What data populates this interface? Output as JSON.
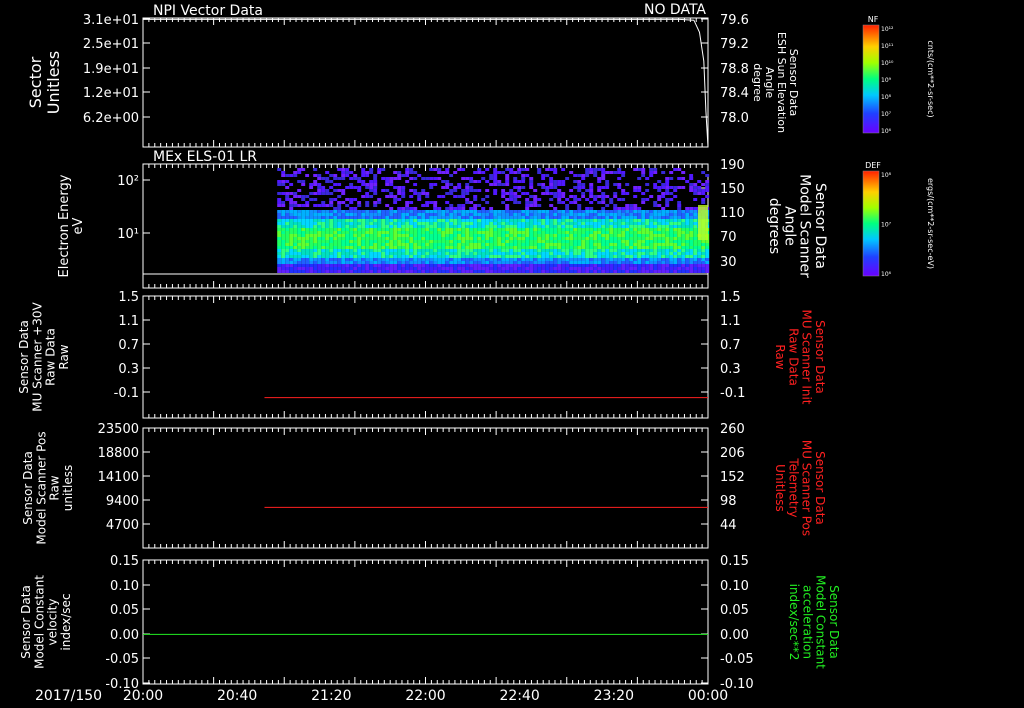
{
  "figure": {
    "date_label": "2017/150",
    "x_ticks": [
      "20:00",
      "20:40",
      "21:20",
      "22:00",
      "22:40",
      "23:20",
      "00:00"
    ],
    "colors": {
      "background": "#000000",
      "axis": "#ffffff",
      "red_trace": "#ff2020",
      "green_trace": "#22ee22"
    }
  },
  "colorbars": [
    {
      "id": "nf",
      "tag": "NF",
      "label": "cnts/(cm**2-sr-sec)",
      "ticks": [
        "10¹²",
        "10¹¹",
        "10¹⁰",
        "10⁹",
        "10⁸",
        "10⁷",
        "10⁶"
      ]
    },
    {
      "id": "def",
      "tag": "DEF",
      "label": "ergs/(cm**2-sr-sec-eV)",
      "ticks": [
        "10⁸",
        "10⁷",
        "10⁶"
      ]
    }
  ],
  "chart_data": [
    {
      "type": "line",
      "title": "NPI Vector Data",
      "status_text": "NO DATA",
      "left_axis": {
        "label_lines": [
          "Sector",
          "Unitless"
        ],
        "ticks": [
          "3.1e+01",
          "2.5e+01",
          "1.9e+01",
          "1.2e+01",
          "6.2e+00"
        ]
      },
      "right_axis": {
        "label_lines": [
          "Sensor Data",
          "ESH Sun Elevation",
          "Angle",
          "degree"
        ],
        "ticks": [
          "79.6",
          "79.2",
          "78.8",
          "78.4",
          "78.0"
        ],
        "ylim": [
          77.8,
          79.6
        ]
      },
      "series": [
        {
          "axis": "right",
          "x_hours": [
            0,
            1,
            2,
            3,
            3.8,
            3.9,
            3.94,
            3.97,
            3.985,
            4.0
          ],
          "values": [
            79.58,
            79.58,
            79.58,
            79.58,
            79.58,
            79.57,
            79.4,
            79.0,
            78.3,
            77.8
          ]
        }
      ]
    },
    {
      "type": "heatmap",
      "title": "MEx ELS-01 LR",
      "left_axis": {
        "label_lines": [
          "Electron Energy",
          "eV"
        ],
        "ticks": [
          "10²",
          "10¹"
        ],
        "scale": "log"
      },
      "right_axis": {
        "label_lines": [
          "Sensor Data",
          "Model Scanner",
          "Angle",
          "degrees"
        ],
        "ticks": [
          "190",
          "150",
          "110",
          "70",
          "30"
        ]
      },
      "data_start_hour": 0.95,
      "data_end_hour": 4.0
    },
    {
      "type": "line",
      "left_axis": {
        "label_lines": [
          "Sensor Data",
          "MU Scanner +30V",
          "Raw Data",
          "Raw"
        ],
        "ticks": [
          "1.5",
          "1.1",
          "0.7",
          "0.3",
          "-0.1"
        ],
        "ylim": [
          -0.3,
          1.5
        ]
      },
      "right_axis": {
        "label_lines": [
          "Sensor Data",
          "MU Scanner Init",
          "Raw Data",
          "Raw"
        ],
        "ticks": [
          "1.5",
          "1.1",
          "0.7",
          "0.3",
          "-0.1"
        ],
        "color": "#ff2020"
      },
      "series": [
        {
          "x_range_hours": [
            0.86,
            4.0
          ],
          "value": 0.0,
          "color": "#ff2020"
        }
      ]
    },
    {
      "type": "line",
      "left_axis": {
        "label_lines": [
          "Sensor Data",
          "Model Scanner Pos",
          "Raw",
          "unitless"
        ],
        "ticks": [
          "23500",
          "18800",
          "14100",
          "9400",
          "4700"
        ],
        "ylim": [
          0,
          23500
        ]
      },
      "right_axis": {
        "label_lines": [
          "Sensor Data",
          "MU Scanner Pos",
          "Telemetry",
          "Unitless"
        ],
        "ticks": [
          "260",
          "206",
          "152",
          "98",
          "44"
        ],
        "ylim": [
          0,
          260
        ],
        "color": "#ff2020"
      },
      "series": [
        {
          "x_range_hours": [
            0.86,
            4.0
          ],
          "value": 88,
          "axis": "right",
          "color": "#ff2020"
        }
      ]
    },
    {
      "type": "line",
      "left_axis": {
        "label_lines": [
          "Sensor Data",
          "Model Constant",
          "velocity",
          "index/sec"
        ],
        "ticks": [
          "0.15",
          "0.10",
          "0.05",
          "0.00",
          "-0.05",
          "-0.10"
        ],
        "ylim": [
          -0.1,
          0.15
        ]
      },
      "right_axis": {
        "label_lines": [
          "Sensor Data",
          "Model Constant",
          "acceleration",
          "index/sec**2"
        ],
        "ticks": [
          "0.15",
          "0.10",
          "0.05",
          "0.00",
          "-0.05",
          "-0.10"
        ],
        "color": "#22ee22"
      },
      "series": [
        {
          "x_range_hours": [
            0,
            4.0
          ],
          "value": 0.0,
          "color": "#22ee22"
        }
      ]
    }
  ]
}
